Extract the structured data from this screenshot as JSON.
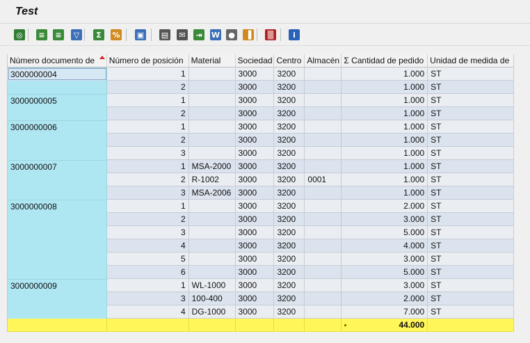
{
  "window": {
    "title": "Test"
  },
  "toolbar": {
    "buttons": [
      {
        "name": "details-button",
        "icon": "magnifier-icon",
        "glyph": "◎",
        "color": "#2f7d32"
      },
      {
        "name": "sort-ascending-button",
        "icon": "sort-ascending-icon",
        "glyph": "≡",
        "color": "#3a8a3a"
      },
      {
        "name": "sort-descending-button",
        "icon": "sort-descending-icon",
        "glyph": "≡",
        "color": "#3a8a3a"
      },
      {
        "name": "filter-button",
        "icon": "filter-icon",
        "glyph": "▽",
        "color": "#3b6fb6"
      },
      {
        "name": "total-button",
        "icon": "sum-icon",
        "glyph": "Σ",
        "color": "#3a8a3a"
      },
      {
        "name": "subtotal-button",
        "icon": "subtotal-icon",
        "glyph": "%",
        "color": "#d08a20"
      },
      {
        "name": "print-preview-button",
        "icon": "print-preview-icon",
        "glyph": "▣",
        "color": "#3b6fb6"
      },
      {
        "name": "export-button",
        "icon": "export-icon",
        "glyph": "▤",
        "color": "#555555"
      },
      {
        "name": "mail-button",
        "icon": "mail-icon",
        "glyph": "✉",
        "color": "#555555"
      },
      {
        "name": "local-file-button",
        "icon": "local-file-icon",
        "glyph": "⇥",
        "color": "#3a8a3a"
      },
      {
        "name": "word-processing-button",
        "icon": "word-icon",
        "glyph": "W",
        "color": "#3b6fb6"
      },
      {
        "name": "find-button",
        "icon": "find-icon",
        "glyph": "●",
        "color": "#666666"
      },
      {
        "name": "graphic-button",
        "icon": "bar-chart-icon",
        "glyph": "▐",
        "color": "#d08a20"
      },
      {
        "name": "layout-button",
        "icon": "layout-grid-icon",
        "glyph": "▒",
        "color": "#b02020"
      },
      {
        "name": "info-button",
        "icon": "info-icon",
        "glyph": "i",
        "color": "#2a62b8"
      }
    ]
  },
  "table": {
    "columns": [
      {
        "label": "Número documento de",
        "sorted": true
      },
      {
        "label": "Número de posición",
        "sorted": false
      },
      {
        "label": "Material",
        "sorted": false
      },
      {
        "label": "Sociedad",
        "sorted": false
      },
      {
        "label": "Centro",
        "sorted": false
      },
      {
        "label": "Almacén",
        "sorted": false
      },
      {
        "label": "Σ Cantidad de pedido",
        "sorted": false
      },
      {
        "label": "Unidad de medida de",
        "sorted": false
      }
    ],
    "rows": [
      [
        "3000000004",
        "1",
        "",
        "3000",
        "3200",
        "",
        "1.000",
        "ST"
      ],
      [
        "",
        "2",
        "",
        "3000",
        "3200",
        "",
        "1.000",
        "ST"
      ],
      [
        "3000000005",
        "1",
        "",
        "3000",
        "3200",
        "",
        "1.000",
        "ST"
      ],
      [
        "",
        "2",
        "",
        "3000",
        "3200",
        "",
        "1.000",
        "ST"
      ],
      [
        "3000000006",
        "1",
        "",
        "3000",
        "3200",
        "",
        "1.000",
        "ST"
      ],
      [
        "",
        "2",
        "",
        "3000",
        "3200",
        "",
        "1.000",
        "ST"
      ],
      [
        "",
        "3",
        "",
        "3000",
        "3200",
        "",
        "1.000",
        "ST"
      ],
      [
        "3000000007",
        "1",
        "MSA-2000",
        "3000",
        "3200",
        "",
        "1.000",
        "ST"
      ],
      [
        "",
        "2",
        "R-1002",
        "3000",
        "3200",
        "0001",
        "1.000",
        "ST"
      ],
      [
        "",
        "3",
        "MSA-2006",
        "3000",
        "3200",
        "",
        "1.000",
        "ST"
      ],
      [
        "3000000008",
        "1",
        "",
        "3000",
        "3200",
        "",
        "2.000",
        "ST"
      ],
      [
        "",
        "2",
        "",
        "3000",
        "3200",
        "",
        "3.000",
        "ST"
      ],
      [
        "",
        "3",
        "",
        "3000",
        "3200",
        "",
        "5.000",
        "ST"
      ],
      [
        "",
        "4",
        "",
        "3000",
        "3200",
        "",
        "4.000",
        "ST"
      ],
      [
        "",
        "5",
        "",
        "3000",
        "3200",
        "",
        "3.000",
        "ST"
      ],
      [
        "",
        "6",
        "",
        "3000",
        "3200",
        "",
        "5.000",
        "ST"
      ],
      [
        "3000000009",
        "1",
        "WL-1000",
        "3000",
        "3200",
        "",
        "3.000",
        "ST"
      ],
      [
        "",
        "3",
        "100-400",
        "3000",
        "3200",
        "",
        "2.000",
        "ST"
      ],
      [
        "",
        "4",
        "DG-1000",
        "3000",
        "3200",
        "",
        "7.000",
        "ST"
      ]
    ],
    "total": {
      "quantity": "44.000"
    }
  },
  "colors": {
    "key_column": "#aee6f2",
    "row_light": "#eaeef3",
    "row_dark": "#dbe3ee",
    "total_row": "#fff65a",
    "sort_marker": "#d9262c"
  }
}
